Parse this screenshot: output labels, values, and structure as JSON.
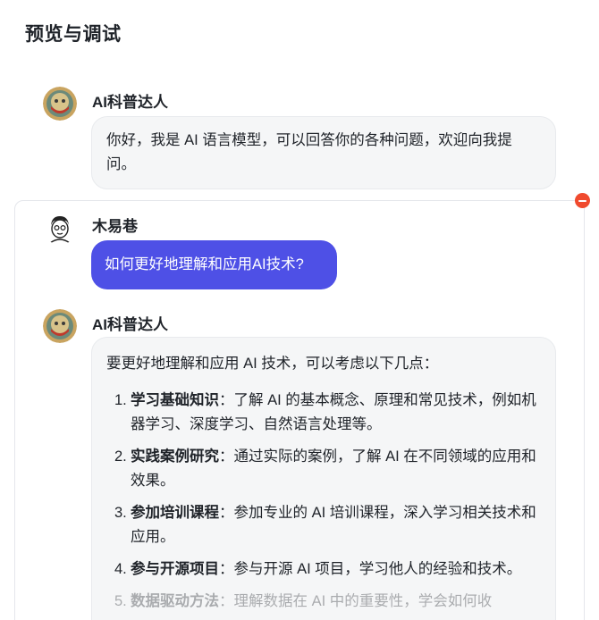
{
  "page": {
    "title": "预览与调试"
  },
  "messages": [
    {
      "sender": "AI科普达人",
      "text": "你好，我是 AI 语言模型，可以回答你的各种问题，欢迎向我提问。"
    },
    {
      "sender": "木易巷",
      "text": "如何更好地理解和应用AI技术?"
    },
    {
      "sender": "AI科普达人",
      "intro": "要更好地理解和应用 AI 技术，可以考虑以下几点：",
      "points": [
        {
          "num": "1.",
          "title": "学习基础知识",
          "text": "：了解 AI 的基本概念、原理和常见技术，例如机器学习、深度学习、自然语言处理等。"
        },
        {
          "num": "2.",
          "title": "实践案例研究",
          "text": "：通过实际的案例，了解 AI 在不同领域的应用和效果。"
        },
        {
          "num": "3.",
          "title": "参加培训课程",
          "text": "：参加专业的 AI 培训课程，深入学习相关技术和应用。"
        },
        {
          "num": "4.",
          "title": "参与开源项目",
          "text": "：参与开源 AI 项目，学习他人的经验和技术。"
        },
        {
          "num": "5.",
          "title": "数据驱动方法",
          "text": "：理解数据在 AI 中的重要性，学会如何收"
        }
      ]
    }
  ],
  "icons": {
    "bot_avatar": "robot-avatar-icon",
    "user_avatar": "cartoon-face-avatar-icon",
    "remove": "remove-badge-icon"
  },
  "colors": {
    "user_bubble": "#4e50e6",
    "bot_bubble": "#f5f6f7",
    "remove_badge": "#f04a2e"
  }
}
